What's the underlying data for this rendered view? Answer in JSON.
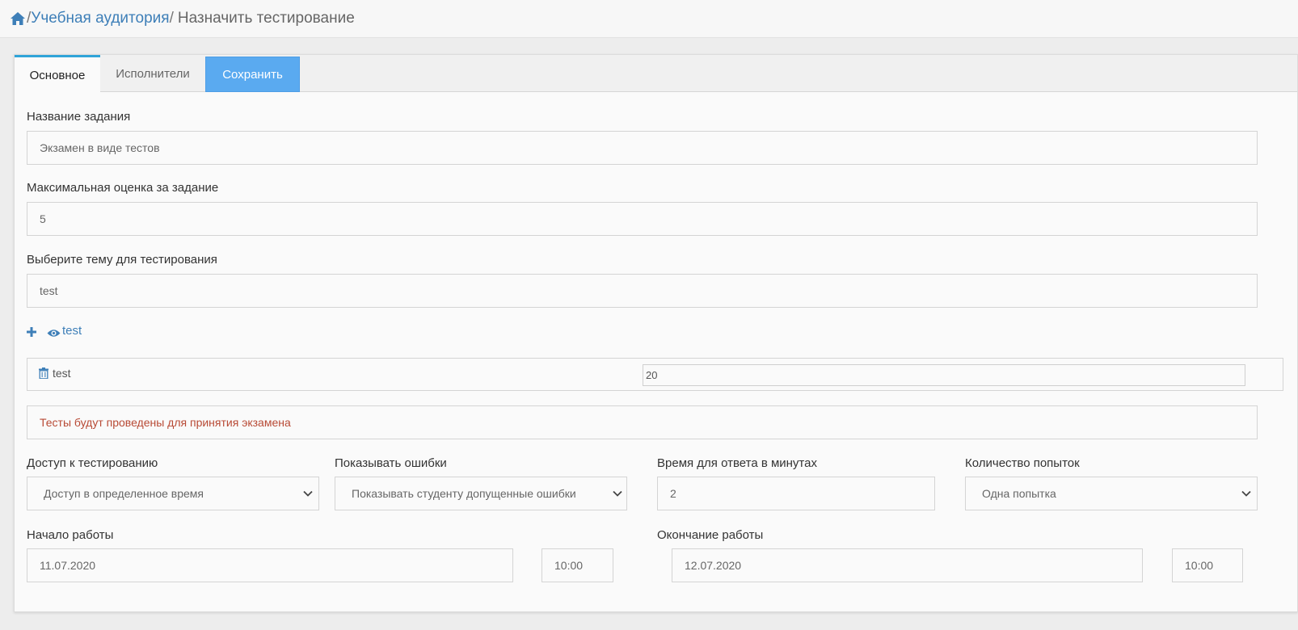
{
  "breadcrumb": {
    "home_icon": "home-icon",
    "separator": "/",
    "link": "Учебная аудитория",
    "current": "Назначить тестирование"
  },
  "tabs": {
    "main": "Основное",
    "performers": "Исполнители",
    "save": "Сохранить"
  },
  "form": {
    "task_name": {
      "label": "Название задания",
      "value": "Экзамен в виде тестов"
    },
    "max_grade": {
      "label": "Максимальная оценка за задание",
      "value": "5"
    },
    "topic": {
      "label": "Выберите тему для тестирования",
      "value": "test"
    },
    "actions": {
      "add_icon": "plus-icon",
      "view_icon": "eye-icon",
      "view_label": "test"
    },
    "topic_row": {
      "delete_icon": "trash-icon",
      "name": "test",
      "count": "20"
    },
    "description": "Тесты будут проведены для принятия экзамена",
    "access": {
      "label": "Доступ к тестированию",
      "value": "Доступ в определенное время"
    },
    "show_errors": {
      "label": "Показывать ошибки",
      "value": "Показывать студенту допущенные ошибки"
    },
    "answer_time": {
      "label": "Время для ответа в минутах",
      "value": "2"
    },
    "attempts": {
      "label": "Количество попыток",
      "value": "Одна попытка"
    },
    "start": {
      "label": "Начало работы",
      "date": "11.07.2020",
      "time": "10:00"
    },
    "end": {
      "label": "Окончание работы",
      "date": "12.07.2020",
      "time": "10:00"
    }
  },
  "colors": {
    "accent_tab": "#2fa4d8",
    "save_button": "#5aaaf0",
    "link": "#3e7fb8",
    "description_text": "#b84a35"
  }
}
